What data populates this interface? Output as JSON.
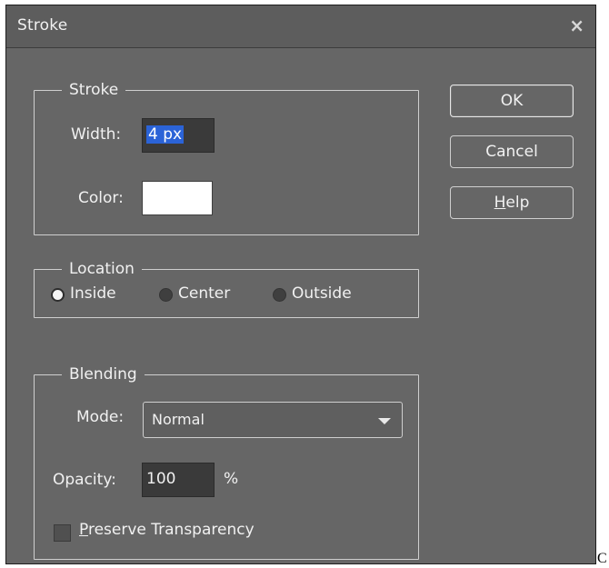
{
  "dialog": {
    "title": "Stroke",
    "close_glyph": "×"
  },
  "stroke": {
    "title": "Stroke",
    "width_label": "Width:",
    "width_value": "4 px",
    "color_label": "Color:",
    "color_value": "#ffffff"
  },
  "location": {
    "title": "Location",
    "options": [
      {
        "label": "Inside",
        "selected": true
      },
      {
        "label": "Center",
        "selected": false
      },
      {
        "label": "Outside",
        "selected": false
      }
    ]
  },
  "blending": {
    "title": "Blending",
    "mode_label": "Mode:",
    "mode_value": "Normal",
    "opacity_label": "Opacity:",
    "opacity_value": "100",
    "opacity_unit": "%",
    "preserve_label_first": "P",
    "preserve_label_rest": "reserve Transparency"
  },
  "buttons": {
    "ok": "OK",
    "cancel": "Cancel",
    "help_first": "H",
    "help_rest": "elp"
  },
  "stray_text": "C"
}
